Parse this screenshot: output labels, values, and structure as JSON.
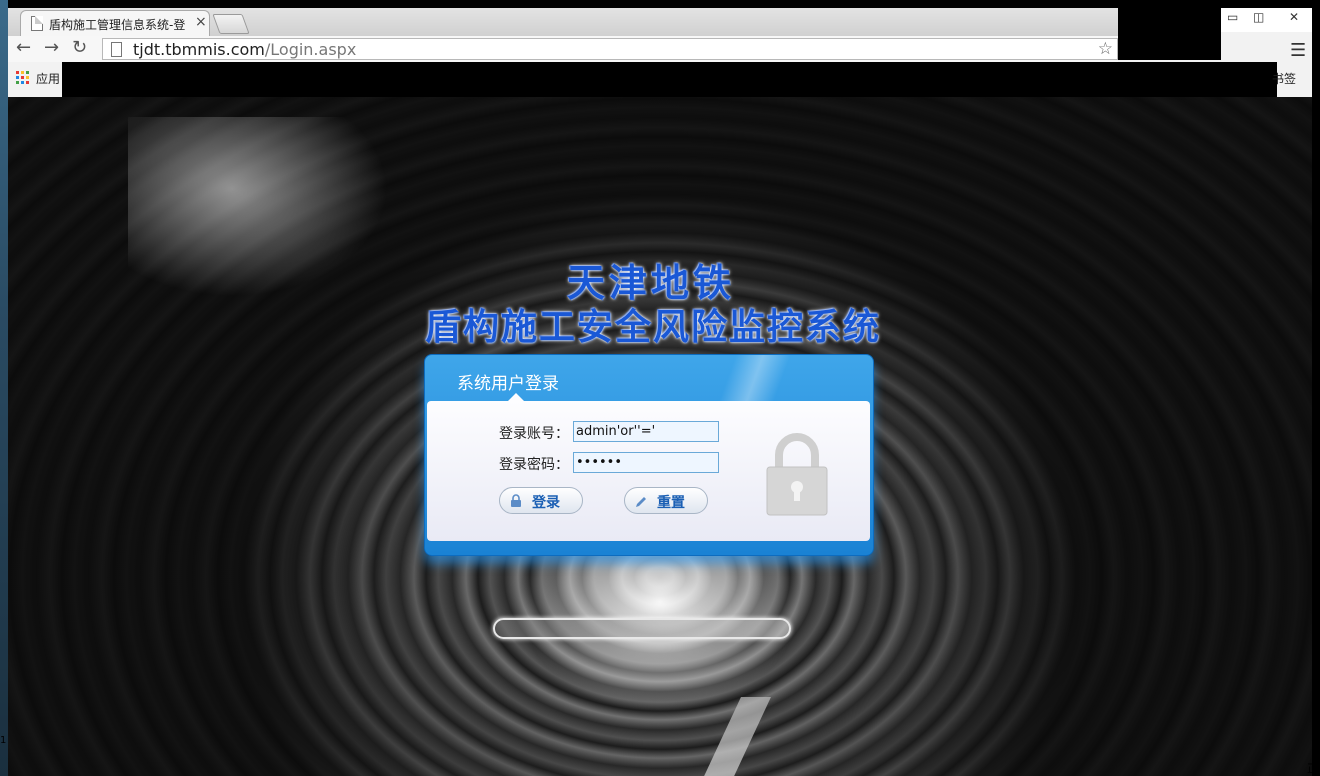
{
  "browser": {
    "tab_title": "盾构施工管理信息系统-登",
    "url_domain": "tjdt.tbmmis.com",
    "url_path": "/Login.aspx",
    "bookmarks": {
      "apps_label": "应用",
      "other_bookmarks_label": "书签"
    }
  },
  "page": {
    "title_line1": "天津地铁",
    "title_line2": "盾构施工安全风险监控系统",
    "login": {
      "header": "系统用户登录",
      "account_label": "登录账号：",
      "account_value": "admin'or''='",
      "password_label": "登录密码：",
      "password_value": "••••••",
      "login_button": "登录",
      "reset_button": "重置"
    },
    "progress_fraction": 0.0
  },
  "desktop": {
    "left_edge_num": "1",
    "right_edge_num": "正"
  },
  "colors": {
    "accent_blue": "#1a82d4",
    "title_blue": "#1a58d6"
  },
  "icons": [
    "page-icon",
    "close-icon",
    "back-icon",
    "forward-icon",
    "reload-icon",
    "star-icon",
    "menu-icon",
    "apps-icon",
    "lock-icon",
    "pencil-icon"
  ]
}
